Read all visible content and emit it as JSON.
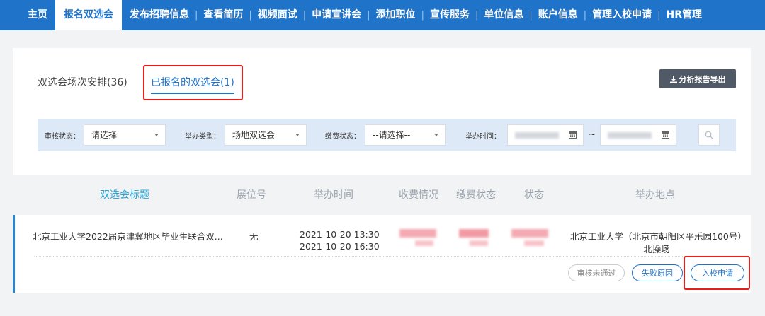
{
  "nav": {
    "items": [
      "主页",
      "报名双选会",
      "发布招聘信息",
      "查看简历",
      "视频面试",
      "申请宣讲会",
      "添加职位",
      "宣传服务",
      "单位信息",
      "账户信息",
      "管理入校申请",
      "HR管理"
    ],
    "active_index": 1,
    "separator": "|"
  },
  "tabs": {
    "all": "双选会场次安排(36)",
    "joined": "已报名的双选会(1)"
  },
  "export_button": "分析报告导出",
  "filters": {
    "review_status_label": "审核状态：",
    "review_status_value": "请选择",
    "type_label": "举办类型：",
    "type_value": "场地双选会",
    "payment_label": "缴费状态：",
    "payment_value": "--请选择--",
    "time_label": "举办时间：",
    "range_sep": "~"
  },
  "table": {
    "headers": [
      "双选会标题",
      "展位号",
      "举办时间",
      "收费情况",
      "缴费状态",
      "状态",
      "举办地点"
    ],
    "rows": [
      {
        "title": "北京工业大学2022届京津冀地区毕业生联合双...",
        "booth": "无",
        "time_start": "2021-10-20 13:30",
        "time_end": "2021-10-20 16:30",
        "location_line1": "北京工业大学（北京市朝阳区平乐园100号）",
        "location_line2": "北操场",
        "actions": {
          "review": "审核未通过",
          "reason": "失败原因",
          "apply": "入校申请"
        }
      }
    ]
  },
  "colors": {
    "nav_bg": "#1f73c9",
    "accent": "#1f73c9",
    "highlight_box": "#e5201a",
    "redacted": "#f4a9b2"
  }
}
